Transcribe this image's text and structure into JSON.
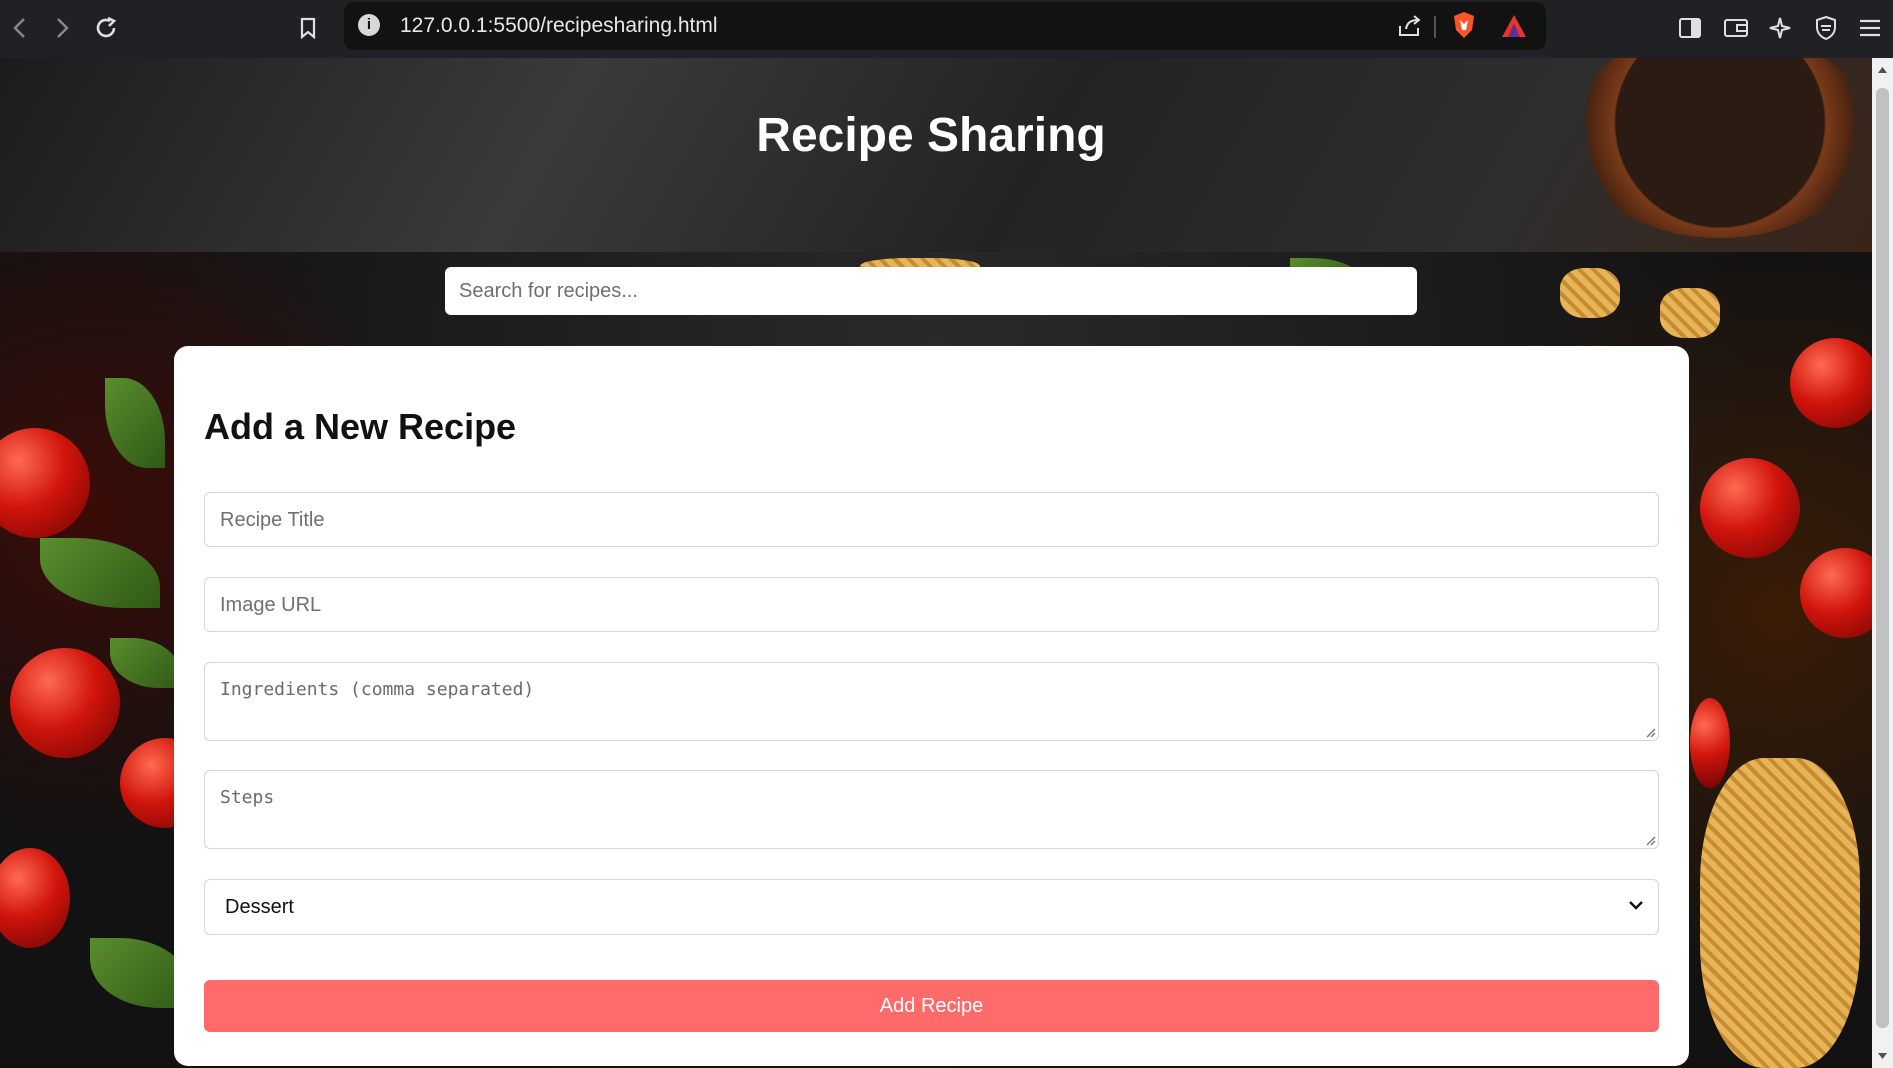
{
  "browser": {
    "url": "127.0.0.1:5500/recipesharing.html"
  },
  "page": {
    "title": "Recipe Sharing",
    "search_placeholder": "Search for recipes..."
  },
  "form": {
    "heading": "Add a New Recipe",
    "title_placeholder": "Recipe Title",
    "image_placeholder": "Image URL",
    "ingredients_placeholder": "Ingredients (comma separated)",
    "steps_placeholder": "Steps",
    "category_value": "Dessert",
    "submit_label": "Add Recipe"
  },
  "colors": {
    "accent": "#ff6b6b",
    "card": "#ffffff"
  }
}
